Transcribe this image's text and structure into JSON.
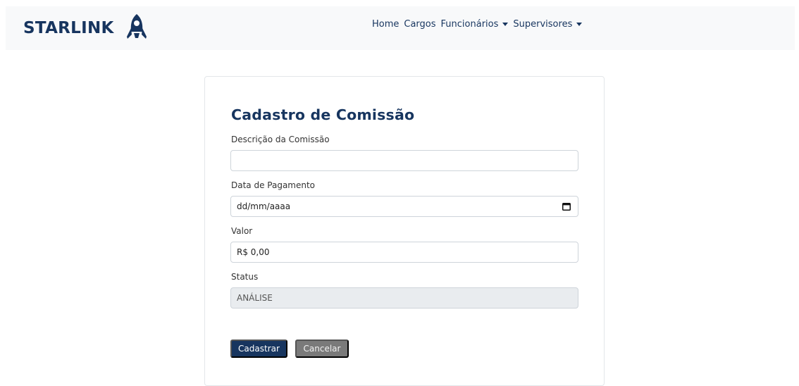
{
  "navbar": {
    "brand": "STARLINK",
    "brand_logo_icon": "rocket-icon",
    "links": [
      {
        "label": "Home",
        "dropdown": false
      },
      {
        "label": "Cargos",
        "dropdown": false
      },
      {
        "label": "Funcionários",
        "dropdown": true
      },
      {
        "label": "Supervisores",
        "dropdown": true
      }
    ]
  },
  "form": {
    "title": "Cadastro de Comissão",
    "description": {
      "label": "Descrição da Comissão",
      "value": ""
    },
    "payment_date": {
      "label": "Data de Pagamento",
      "value": "dd/mm/aaaa",
      "icon": "calendar-icon"
    },
    "amount": {
      "label": "Valor",
      "value": "R$ 0,00"
    },
    "status": {
      "label": "Status",
      "value": "ANÁLISE",
      "disabled": true
    },
    "submit_label": "Cadastrar",
    "cancel_label": "Cancelar"
  },
  "colors": {
    "brand": "#17355f",
    "navbar_bg": "#f8f9fa",
    "primary_button": "#17355f",
    "secondary_button": "#7a7a7a",
    "disabled_input": "#e9ecef"
  }
}
